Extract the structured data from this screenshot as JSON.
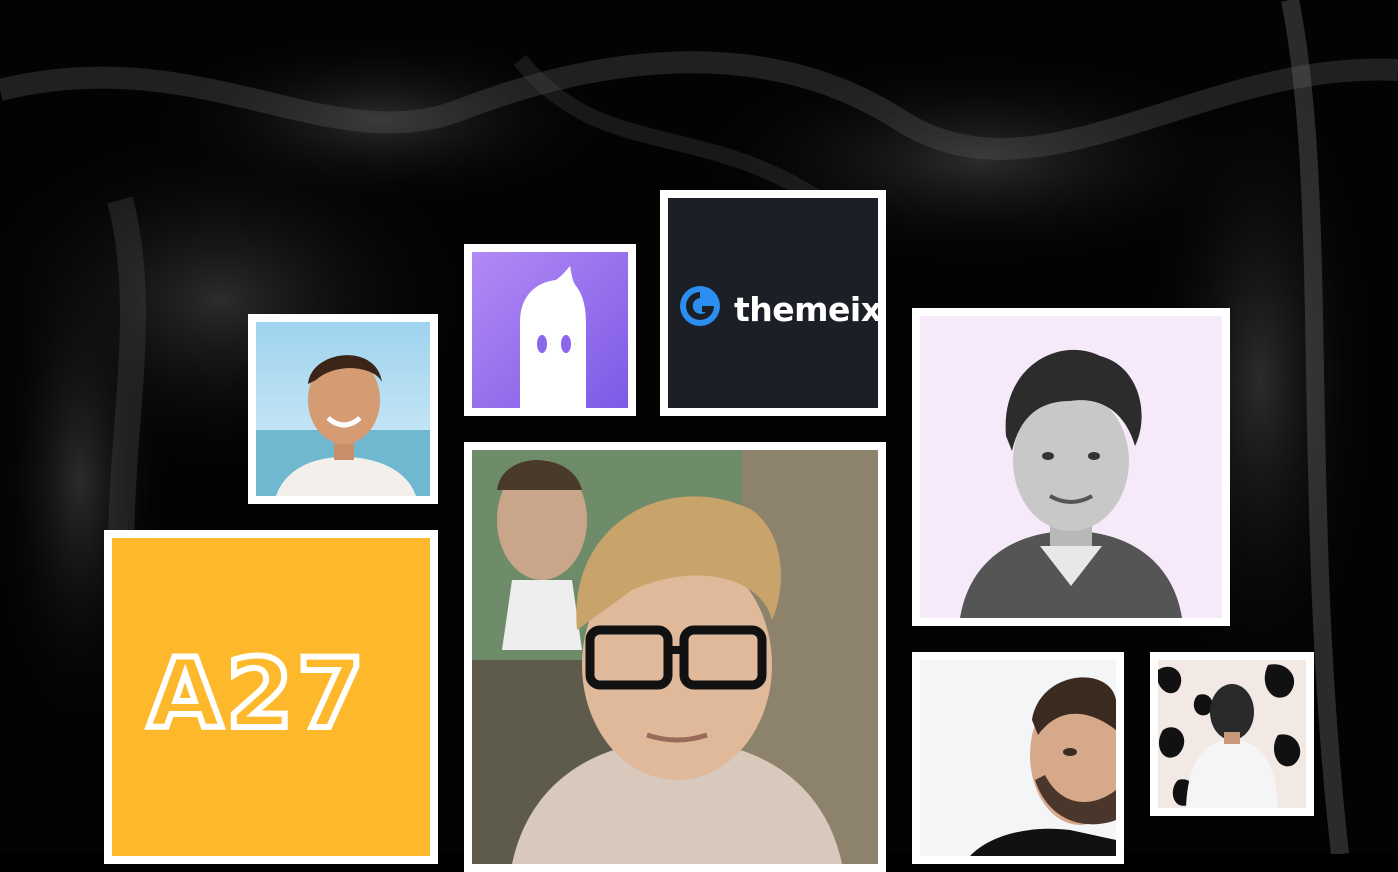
{
  "brand": {
    "themeix_label": "themeix",
    "a27_label": "A27"
  },
  "colors": {
    "background": "#000000",
    "frame": "#ffffff",
    "themeix_bg": "#1c1f26",
    "themeix_blue": "#2b8ef0",
    "ghost_top": "#b28af5",
    "ghost_bottom": "#7d5ae6",
    "a27_yellow": "#fdb92b",
    "portrait_pink_bg": "#f6eafa"
  },
  "icons": [
    "ghost-logo-icon",
    "themeix-logo-icon",
    "a27-logo-icon"
  ]
}
